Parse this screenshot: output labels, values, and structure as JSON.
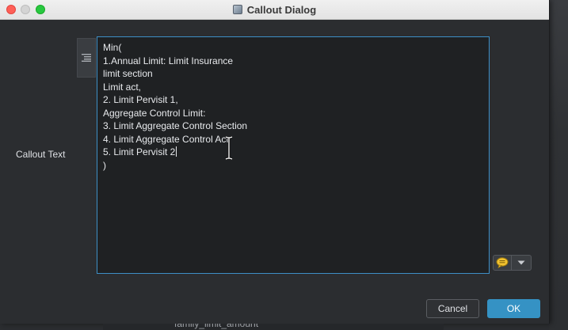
{
  "window": {
    "title": "Callout Dialog"
  },
  "form": {
    "callout_label": "Callout Text",
    "callout_lines": [
      "Min(",
      "1.Annual Limit: Limit Insurance",
      "limit section",
      "Limit act,",
      "2. Limit Pervisit 1,",
      "Aggregate Control Limit:",
      "3. Limit Aggregate Control Section",
      "4. Limit Aggregate Control Act",
      "5. Limit Pervisit 2",
      ")"
    ]
  },
  "buttons": {
    "cancel": "Cancel",
    "ok": "OK"
  },
  "background": {
    "underlying_text": "family_limit_amount"
  },
  "icons": {
    "gutter": "list-icon",
    "annotation": "speech-bubble-icon",
    "dropdown": "chevron-down-icon",
    "cursor": "text-cursor-icon"
  },
  "colors": {
    "accent": "#3592c4",
    "editor_border": "#3d8fc6"
  }
}
